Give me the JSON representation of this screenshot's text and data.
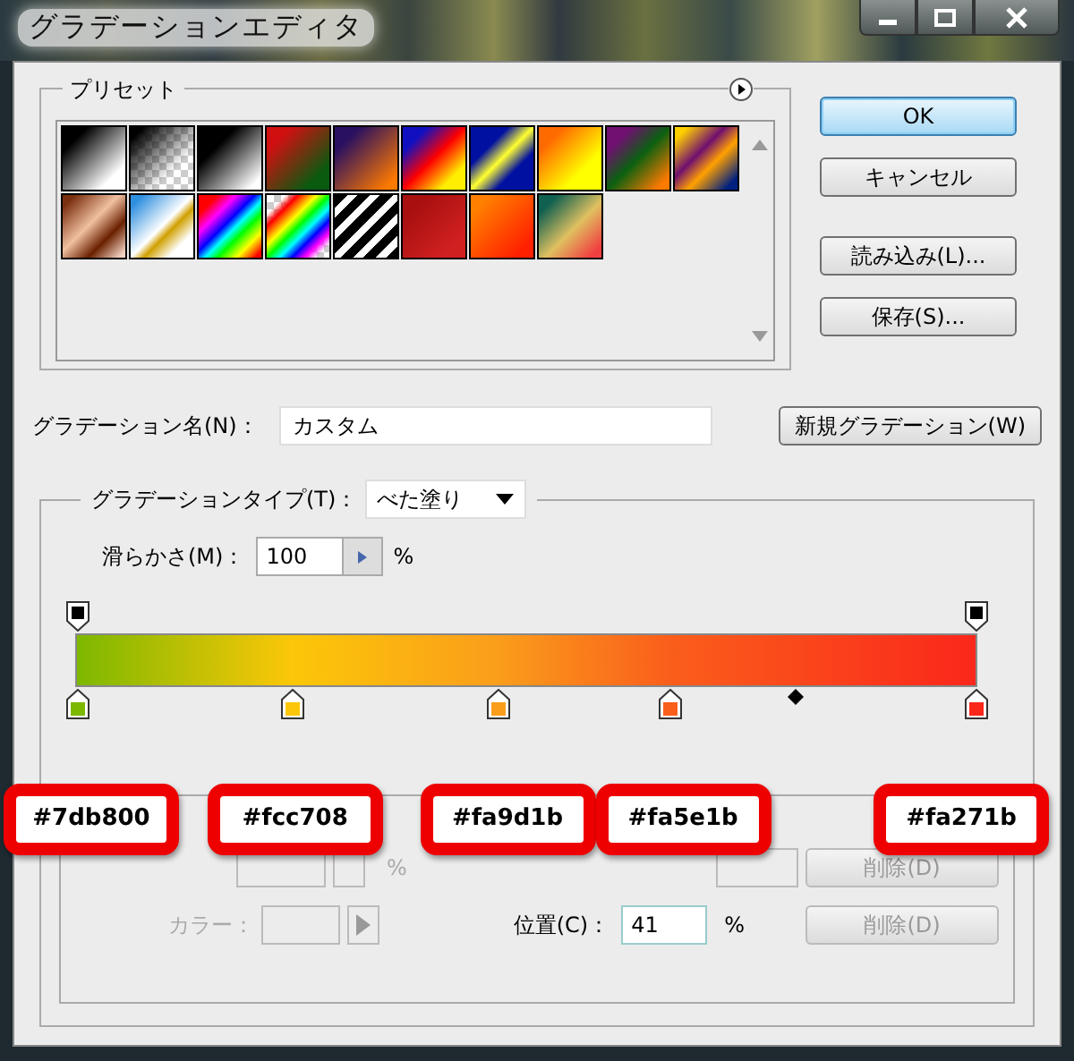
{
  "window": {
    "title": "グラデーションエディタ"
  },
  "presets": {
    "label": "プリセット"
  },
  "buttons": [
    {
      "label": "OK",
      "default": true
    },
    {
      "label": "キャンセル",
      "default": false
    },
    {
      "label": "読み込み(L)...",
      "default": false
    },
    {
      "label": "保存(S)...",
      "default": false
    }
  ],
  "name_field": {
    "label": "グラデーション名(N)：",
    "value": "カスタム",
    "button": "新規グラデーション(W)"
  },
  "gradient_type": {
    "label": "グラデーションタイプ(T)：",
    "value": "べた塗り"
  },
  "smoothness": {
    "label": "滑らかさ(M)：",
    "value": "100",
    "unit": "%"
  },
  "opacity_stops": [
    {
      "level": 0
    },
    {
      "level": 1
    }
  ],
  "color_stops": [
    {
      "color": "#7db800",
      "level": 0,
      "callout": "#7db800"
    },
    {
      "color": "#fcc708",
      "level": 0.24,
      "callout": "#fcc708"
    },
    {
      "color": "#fa9d1b",
      "level": 0.47,
      "callout": "#fa9d1b"
    },
    {
      "color": "#fa5e1b",
      "level": 0.66,
      "callout": "#fa5e1b"
    },
    {
      "color": "#fa271b",
      "level": 1,
      "callout": "#fa271b"
    }
  ],
  "midpoint": {
    "level": 0.8
  },
  "opacity_row": {
    "unit": "%",
    "delete_button": {
      "label": "削除(D)",
      "disabled": true
    }
  },
  "color_row": {
    "label": "カラー：",
    "disabled": true,
    "position_label": "位置(C)：",
    "position_value": "41",
    "unit": "%",
    "delete_button": {
      "label": "削除(D)",
      "disabled": true
    }
  }
}
